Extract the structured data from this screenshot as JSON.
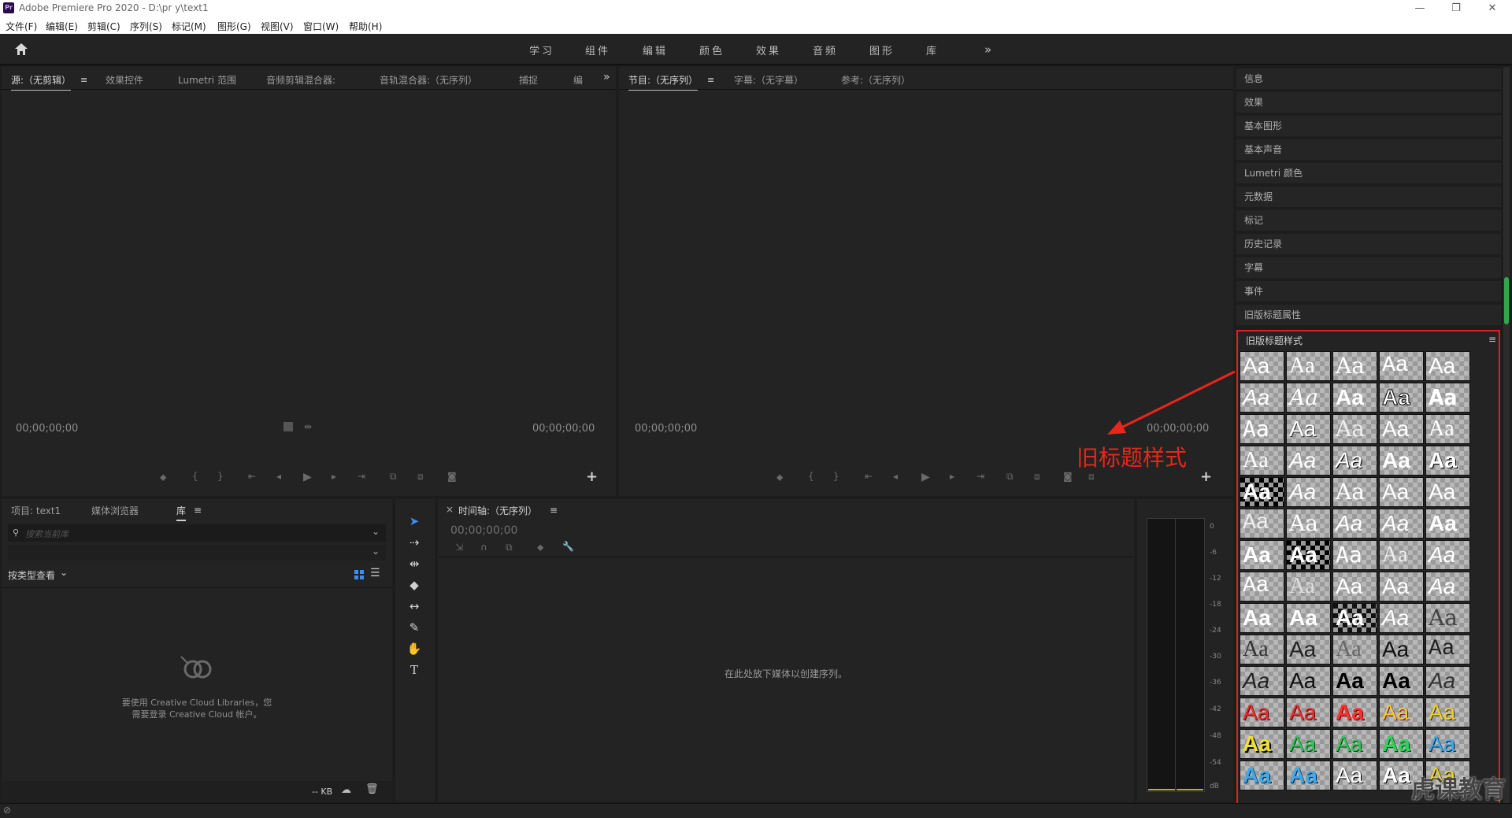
{
  "window": {
    "title": "Adobe Premiere Pro 2020 - D:\\pr y\\text1",
    "logo": "Pr",
    "min": "—",
    "restore": "❐",
    "close": "✕"
  },
  "menu": [
    "文件(F)",
    "编辑(E)",
    "剪辑(C)",
    "序列(S)",
    "标记(M)",
    "图形(G)",
    "视图(V)",
    "窗口(W)",
    "帮助(H)"
  ],
  "workspaces": [
    "学习",
    "组件",
    "编辑",
    "颜色",
    "效果",
    "音频",
    "图形",
    "库"
  ],
  "workspace_more": "»",
  "source_panel": {
    "tabs": [
      "源:（无剪辑）",
      "效果控件",
      "Lumetri 范围",
      "音频剪辑混合器:",
      "音轨混合器:（无序列）",
      "捕捉",
      "编"
    ],
    "more": "»",
    "tc_left": "00;00;00;00",
    "tc_right": "00;00;00;00"
  },
  "program_panel": {
    "tabs": [
      "节目:（无序列）",
      "字幕:（无字幕）",
      "参考:（无序列）"
    ],
    "tc_left": "00;00;00;00",
    "tc_right": "00;00;00;00"
  },
  "controls": {
    "marker": "⬥",
    "in": "{",
    "out": "}",
    "goto_in": "⇤",
    "step_back": "◂",
    "play": "▶",
    "step_fwd": "▸",
    "goto_out": "⇥",
    "insert": "⧉",
    "overwrite": "⧈",
    "camera": "◙",
    "add": "+"
  },
  "side_panels": [
    "信息",
    "效果",
    "基本图形",
    "基本声音",
    "Lumetri 颜色",
    "元数据",
    "标记",
    "历史记录",
    "字幕",
    "事件",
    "旧版标题属性"
  ],
  "styles_panel": {
    "title": "旧版标题样式",
    "menu": "≡",
    "sample": "Aa"
  },
  "annotation": {
    "label": "旧标题样式",
    "color": "#e8261c"
  },
  "project_panel": {
    "tabs": [
      "项目: text1",
      "媒体浏览器",
      "库"
    ],
    "search_placeholder": "搜索当前库",
    "view_by": "按类型查看",
    "cc_message_1": "要使用 Creative Cloud Libraries，您",
    "cc_message_2": "需要登录 Creative Cloud 帐户。",
    "kb": "-- KB"
  },
  "timeline": {
    "tab": "时间轴:（无序列）",
    "close": "×",
    "timecode": "00;00;00;00",
    "empty_message": "在此处放下媒体以创建序列。"
  },
  "meter": {
    "ticks": [
      "0",
      "-6",
      "-12",
      "-18",
      "-24",
      "-30",
      "-36",
      "-42",
      "-48",
      "-54",
      "dB"
    ]
  },
  "watermark": "虎课教育"
}
